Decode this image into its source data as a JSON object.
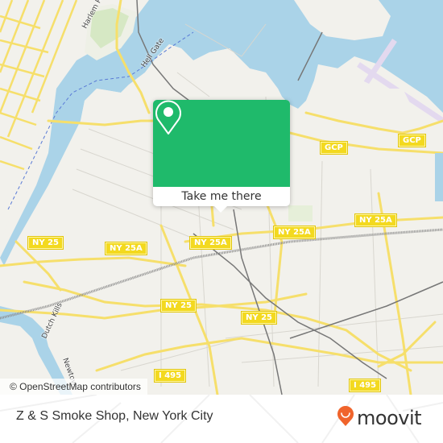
{
  "map": {
    "labels": {
      "harlem_river": "Harlem River",
      "hell_gate": "Hell Gate",
      "dutch_kills": "Dutch Kills",
      "newtown": "Newtown"
    },
    "shields": [
      {
        "id": "gcp-1",
        "text": "GCP"
      },
      {
        "id": "gcp-2",
        "text": "GCP"
      },
      {
        "id": "ny25a-1",
        "text": "NY 25A"
      },
      {
        "id": "ny25a-2",
        "text": "NY 25A"
      },
      {
        "id": "ny25a-3",
        "text": "NY 25A"
      },
      {
        "id": "ny25a-4",
        "text": "NY 25A"
      },
      {
        "id": "ny25-1",
        "text": "NY 25"
      },
      {
        "id": "ny25-2",
        "text": "NY 25"
      },
      {
        "id": "ny25-3",
        "text": "NY 25"
      },
      {
        "id": "i495-1",
        "text": "I 495"
      },
      {
        "id": "i495-2",
        "text": "I 495"
      }
    ],
    "attribution": "© OpenStreetMap contributors",
    "colors": {
      "land": "#f2f1ec",
      "water": "#aad3e8",
      "road_major": "#f6df6b",
      "park": "#d6e8c4",
      "airport": "#e8e0f0"
    }
  },
  "popup": {
    "icon": "location-pin-icon",
    "button_label": "Take me there",
    "accent": "#1fba6b"
  },
  "footer": {
    "place_title": "Z & S Smoke Shop, New York City",
    "brand_name": "moovit",
    "brand_icon": "moovit-smile-pin-icon",
    "brand_color": "#f0642c"
  }
}
